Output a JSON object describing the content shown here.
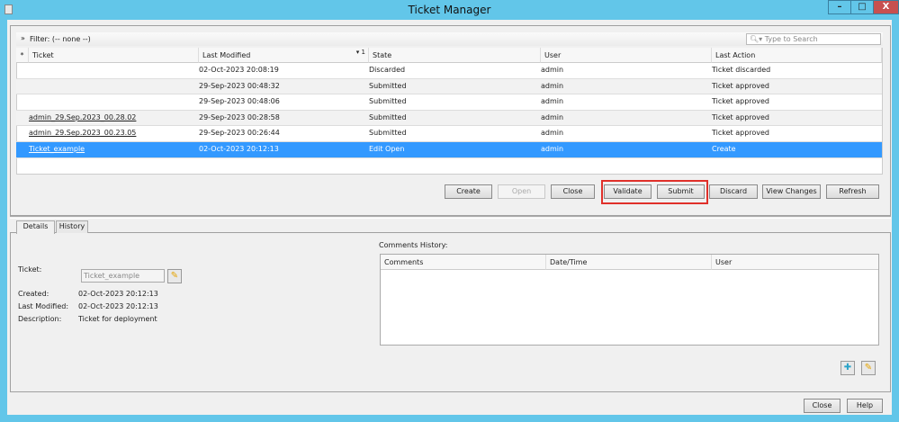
{
  "window": {
    "title": "Ticket Manager",
    "minimize": "–",
    "maximize": "□",
    "close": "X"
  },
  "filter": {
    "label": "Filter: (-- none --)",
    "toggle_icon": "»",
    "search_placeholder": "Type to Search"
  },
  "table": {
    "columns": [
      "*",
      "Ticket",
      "Last Modified",
      "State",
      "User",
      "Last Action"
    ],
    "sort_indicator": "▾ 1",
    "rows": [
      {
        "ticket": "",
        "modified": "02-Oct-2023 20:08:19",
        "state": "Discarded",
        "user": "admin",
        "action": "Ticket discarded"
      },
      {
        "ticket": "",
        "modified": "29-Sep-2023 00:48:32",
        "state": "Submitted",
        "user": "admin",
        "action": "Ticket approved"
      },
      {
        "ticket": "",
        "modified": "29-Sep-2023 00:48:06",
        "state": "Submitted",
        "user": "admin",
        "action": "Ticket approved"
      },
      {
        "ticket": "admin_29.Sep.2023_00.28.02",
        "modified": "29-Sep-2023 00:28:58",
        "state": "Submitted",
        "user": "admin",
        "action": "Ticket approved"
      },
      {
        "ticket": "admin_29.Sep.2023_00.23.05",
        "modified": "29-Sep-2023 00:26:44",
        "state": "Submitted",
        "user": "admin",
        "action": "Ticket approved"
      },
      {
        "ticket": "Ticket_example",
        "modified": "02-Oct-2023 20:12:13",
        "state": "Edit Open",
        "user": "admin",
        "action": "Create"
      }
    ]
  },
  "actions": {
    "create": "Create",
    "open": "Open",
    "close": "Close",
    "validate": "Validate",
    "submit": "Submit",
    "discard": "Discard",
    "view_changes": "View Changes",
    "refresh": "Refresh"
  },
  "tabs": {
    "details": "Details",
    "history": "History"
  },
  "details": {
    "ticket_label": "Ticket:",
    "ticket_value": "Ticket_example",
    "created_label": "Created:",
    "created_value": "02-Oct-2023 20:12:13",
    "modified_label": "Last Modified:",
    "modified_value": "02-Oct-2023 20:12:13",
    "description_label": "Description:",
    "description_value": "Ticket for deployment"
  },
  "comments": {
    "title": "Comments History:",
    "columns": [
      "Comments",
      "Date/Time",
      "User"
    ]
  },
  "footer": {
    "close": "Close",
    "help": "Help"
  },
  "colors": {
    "titlebar": "#62c6e9",
    "selection": "#3399ff",
    "highlight": "#e0302a"
  }
}
